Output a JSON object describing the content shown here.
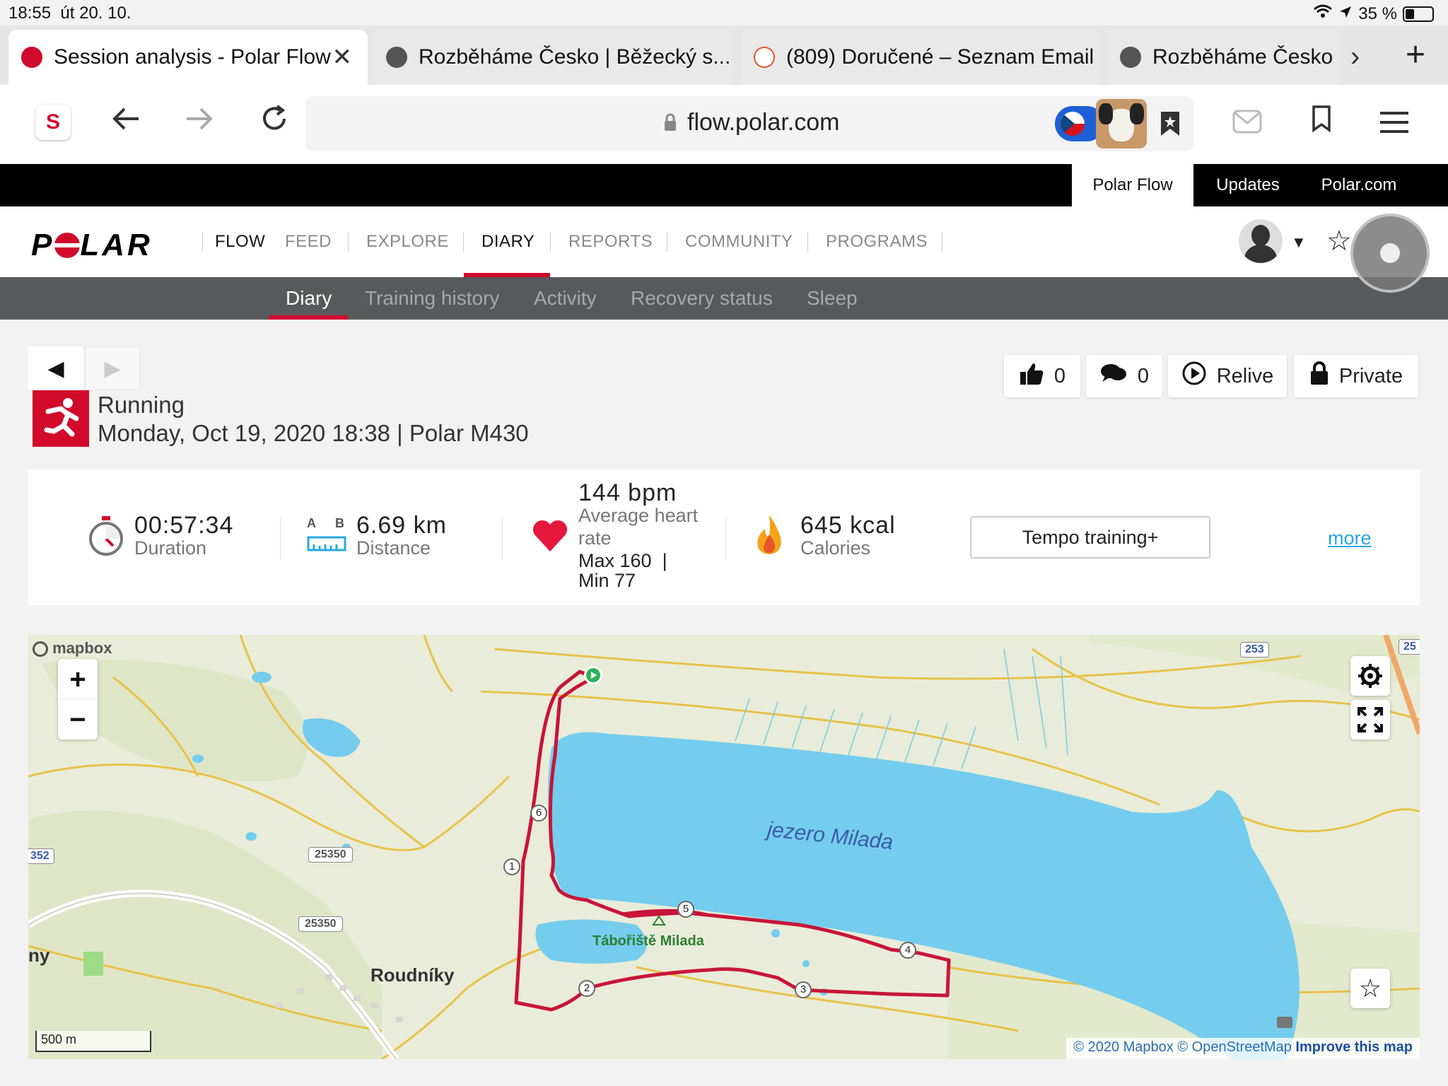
{
  "status_bar": {
    "time": "18:55",
    "date": "út 20. 10.",
    "battery": "35 %"
  },
  "tabs": [
    {
      "label": "Session analysis - Polar Flow",
      "active": true
    },
    {
      "label": "Rozběháme Česko | Běžecký s..."
    },
    {
      "label": "(809) Doručené – Seznam Email"
    },
    {
      "label": "Rozběháme Česko"
    }
  ],
  "toolbar": {
    "url": "flow.polar.com"
  },
  "top_links": [
    "Polar Flow",
    "Updates",
    "Polar.com"
  ],
  "nav": {
    "logo": "POLAR",
    "flow": "FLOW",
    "items": [
      "FEED",
      "EXPLORE",
      "DIARY",
      "REPORTS",
      "COMMUNITY",
      "PROGRAMS"
    ],
    "active": "DIARY"
  },
  "subnav": {
    "items": [
      "Diary",
      "Training history",
      "Activity",
      "Recovery status",
      "Sleep"
    ],
    "active": "Diary"
  },
  "session": {
    "sport": "Running",
    "date_device": "Monday, Oct 19, 2020 18:38 | Polar M430",
    "likes": "0",
    "comments": "0",
    "relive_label": "Relive",
    "privacy_label": "Private"
  },
  "summary": {
    "duration_value": "00:57:34",
    "duration_label": "Duration",
    "distance_value": "6.69 km",
    "distance_label": "Distance",
    "distance_icon_a": "A",
    "distance_icon_b": "B",
    "hr_value": "144 bpm",
    "hr_label_1": "Average heart",
    "hr_label_2": "rate",
    "hr_max": "Max 160",
    "hr_min": "Min 77",
    "calories_value": "645 kcal",
    "calories_label": "Calories",
    "training_benefit": "Tempo training+",
    "more_link": "more"
  },
  "map": {
    "lake_label": "jezero Milada",
    "camp_label": "Tábořiště Milada",
    "town_label": "Roudníky",
    "partial_label_left": "ny",
    "road_labels": [
      "253",
      "25",
      "352",
      "25350",
      "25350"
    ],
    "waypoints": [
      "1",
      "2",
      "3",
      "4",
      "5",
      "6"
    ],
    "scale_label": "500 m",
    "mapbox_logo": "mapbox",
    "attribution_1": "© 2020 Mapbox",
    "attribution_2": "© OpenStreetMap",
    "attribution_3": "Improve this map",
    "colors": {
      "water": "#74cdee",
      "route": "#c8153a",
      "land": "#e9ecd8",
      "road": "#e8c24a"
    }
  }
}
